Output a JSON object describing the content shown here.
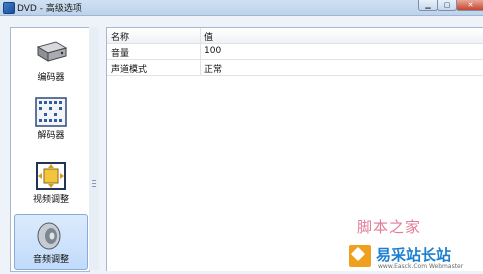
{
  "window": {
    "title": "DVD - 高级选项",
    "buttons": {
      "minimize": "▁",
      "maximize": "▢",
      "close": "✕"
    }
  },
  "sidebar": {
    "items": [
      {
        "label": "编码器",
        "icon": "hard-drive-icon",
        "selected": false
      },
      {
        "label": "解码器",
        "icon": "film-grid-icon",
        "selected": false
      },
      {
        "label": "视频调整",
        "icon": "video-adjust-icon",
        "selected": false
      },
      {
        "label": "音频调整",
        "icon": "speaker-icon",
        "selected": true
      }
    ]
  },
  "properties": {
    "headers": {
      "name": "名称",
      "value": "值"
    },
    "rows": [
      {
        "name": "音量",
        "value": "100"
      },
      {
        "name": "声道模式",
        "value": "正常"
      }
    ]
  },
  "watermark": {
    "script_text": "脚本之家",
    "site_name": "易采站长站",
    "url": "www.Easck.Com Webmaster"
  },
  "colors": {
    "selection": "#c1dbfb",
    "titlebar": "#c6d9ee",
    "close_button": "#c7442d"
  }
}
